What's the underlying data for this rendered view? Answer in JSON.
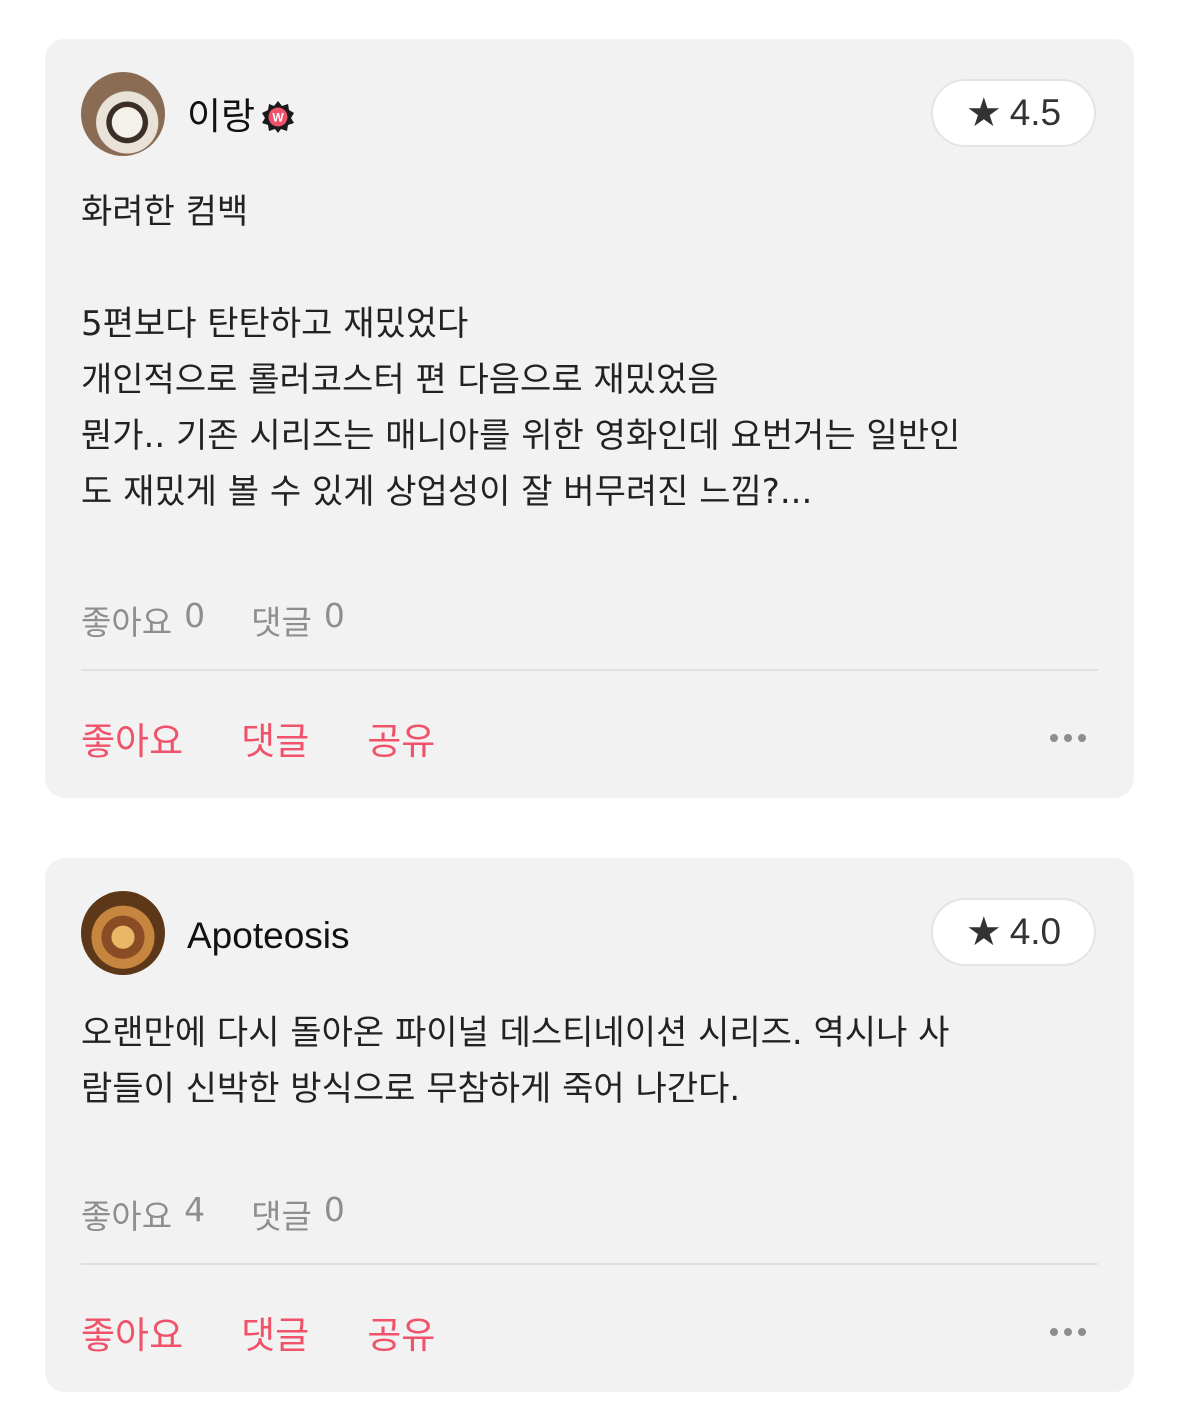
{
  "reviews": [
    {
      "username": "이랑",
      "badge_icon": "watcha-pedia-badge-icon",
      "rating": "4.5",
      "text": "화려한 컴백\n\n5편보다 탄탄하고 재밌었다\n개인적으로 롤러코스터 편 다음으로 재밌었음\n뭔가.. 기존 시리즈는 매니아를 위한 영화인데 요번거는 일반인\n도 재밌게 볼 수 있게 상업성이 잘 버무려진 느낌?...",
      "likes_label": "좋아요",
      "likes_count": "0",
      "comments_label": "댓글",
      "comments_count": "0",
      "action_like": "좋아요",
      "action_comment": "댓글",
      "action_share": "공유"
    },
    {
      "username": "Apoteosis",
      "rating": "4.0",
      "text": "오랜만에 다시 돌아온 파이널 데스티네이션 시리즈. 역시나 사\n람들이 신박한 방식으로 무참하게 죽어 나간다.",
      "likes_label": "좋아요",
      "likes_count": "4",
      "comments_label": "댓글",
      "comments_count": "0",
      "action_like": "좋아요",
      "action_comment": "댓글",
      "action_share": "공유"
    }
  ],
  "colors": {
    "accent": "#f0526a",
    "card_bg": "#f2f2f2",
    "muted": "#8e8e8e"
  }
}
